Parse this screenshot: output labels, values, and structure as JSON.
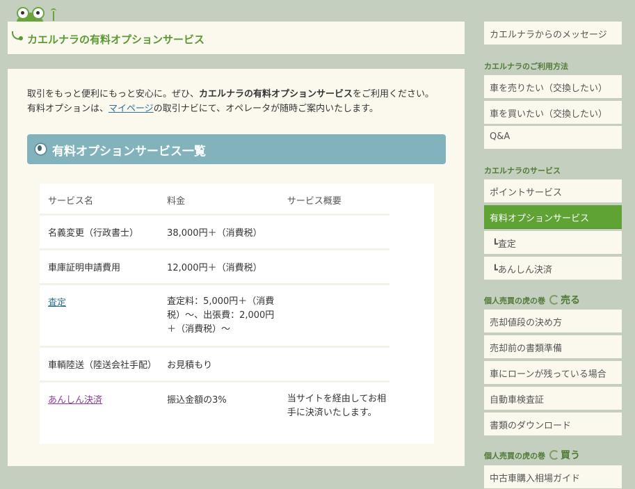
{
  "header": {
    "title": "カエルナラの有料オプションサービス"
  },
  "intro": {
    "line1_pre": "取引をもっと便利にもっと安心に。ぜひ、",
    "line1_bold": "カエルナラの有料オプションサービス",
    "line1_post": "をご利用ください。",
    "line2_pre": "有料オプションは、",
    "line2_link": "マイページ",
    "line2_post": "の取引ナビにて、オペレータが随時ご案内いたします。"
  },
  "section": {
    "title": "有料オプションサービス一覧"
  },
  "table": {
    "headers": [
      "サービス名",
      "料金",
      "サービス概要"
    ],
    "rows": [
      {
        "name": "名義変更（行政書士）",
        "price": "38,000円＋（消費税）",
        "summary": ""
      },
      {
        "name": "車庫証明申請費用",
        "price": "12,000円＋（消費税）",
        "summary": ""
      },
      {
        "name": "査定",
        "price": "査定料：5,000円＋（消費税）～、出張費：2,000円＋（消費税）～",
        "summary": ""
      },
      {
        "name": "車輌陸送（陸送会社手配）",
        "price": "お見積もり",
        "summary": ""
      },
      {
        "name": "あんしん決済",
        "price": "振込金額の3%",
        "summary": "当サイトを経由してお相手に決済いたします。"
      }
    ]
  },
  "sidebar": {
    "top_item": "カエルナラからのメッセージ",
    "usage_heading": "カエルナラのご利用方法",
    "usage_items": [
      "車を売りたい（交換したい）",
      "車を買いたい（交換したい）",
      "Q&A"
    ],
    "service_heading": "カエルナラのサービス",
    "service_items": [
      "ポイントサービス",
      "有料オプションサービス",
      "┗査定",
      "┗あんしん決済"
    ],
    "sell_heading": "個人売買の虎の巻",
    "sell_heading_big": "売る",
    "sell_items": [
      "売却値段の決め方",
      "売却前の書類準備",
      "車にローンが残っている場合",
      "自動車検査証",
      "書類のダウンロード"
    ],
    "buy_heading": "個人売買の虎の巻",
    "buy_heading_big": "買う",
    "buy_items": [
      "中古車購入相場ガイド"
    ]
  },
  "colors": {
    "accent_green": "#5fa335",
    "section_blue": "#82b3bd",
    "link_blue": "#2e6f96",
    "visited_purple": "#8a3f92",
    "page_bg": "#c5cfbf",
    "panel_bg": "#fbf8ee"
  }
}
